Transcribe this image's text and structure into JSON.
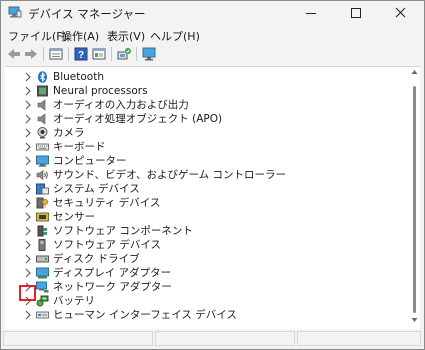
{
  "window": {
    "title": "デバイス マネージャー"
  },
  "menubar": {
    "items": [
      "ファイル(F)",
      "操作(A)",
      "表示(V)",
      "ヘルプ(H)"
    ]
  },
  "toolbar": {
    "buttons": [
      "back-arrow-icon",
      "forward-arrow-icon",
      "properties-icon",
      "help-icon",
      "details-icon",
      "scan-hardware-icon",
      "monitor-icon"
    ]
  },
  "tree": {
    "items": [
      {
        "label": "Bluetooth",
        "icon": "bluetooth-icon"
      },
      {
        "label": "Neural processors",
        "icon": "chip-icon"
      },
      {
        "label": "オーディオの入力および出力",
        "icon": "speaker-icon"
      },
      {
        "label": "オーディオ処理オブジェクト (APO)",
        "icon": "speaker-icon"
      },
      {
        "label": "カメラ",
        "icon": "camera-icon"
      },
      {
        "label": "キーボード",
        "icon": "keyboard-icon"
      },
      {
        "label": "コンピューター",
        "icon": "computer-icon"
      },
      {
        "label": "サウンド、ビデオ、およびゲーム コントローラー",
        "icon": "sound-icon"
      },
      {
        "label": "システム デバイス",
        "icon": "system-device-icon"
      },
      {
        "label": "セキュリティ デバイス",
        "icon": "security-key-icon"
      },
      {
        "label": "センサー",
        "icon": "sensor-icon"
      },
      {
        "label": "ソフトウェア コンポーネント",
        "icon": "software-component-icon"
      },
      {
        "label": "ソフトウェア デバイス",
        "icon": "software-device-icon"
      },
      {
        "label": "ディスク ドライブ",
        "icon": "disk-drive-icon"
      },
      {
        "label": "ディスプレイ アダプター",
        "icon": "display-adapter-icon"
      },
      {
        "label": "ネットワーク アダプター",
        "icon": "network-adapter-icon"
      },
      {
        "label": "バッテリ",
        "icon": "battery-icon"
      },
      {
        "label": "ヒューマン インターフェイス デバイス",
        "icon": "hid-icon"
      }
    ],
    "highlighted_item": "ネットワーク アダプター"
  },
  "colors": {
    "highlight_border": "#e0202a",
    "window_bg": "#f3f3f3",
    "pane_bg": "#ffffff"
  }
}
